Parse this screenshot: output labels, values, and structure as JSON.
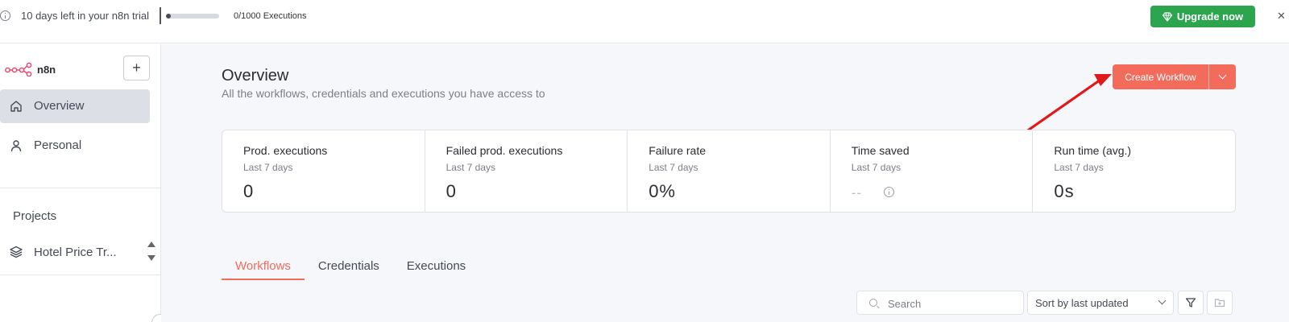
{
  "banner": {
    "trial_text": "10 days left in your n8n trial",
    "executions_text": "0/1000 Executions",
    "executions_progress": 0,
    "upgrade_label": "Upgrade now",
    "upgrade_color": "#2da44e"
  },
  "sidebar": {
    "logo_text": "n8n",
    "add_label": "+",
    "items": [
      {
        "label": "Overview",
        "icon": "home-icon",
        "active": true
      },
      {
        "label": "Personal",
        "icon": "user-icon",
        "active": false
      }
    ],
    "projects_label": "Projects",
    "projects": [
      {
        "label": "Hotel Price Tr...",
        "icon": "layers-icon"
      }
    ]
  },
  "main": {
    "title": "Overview",
    "subtitle": "All the workflows, credentials and executions you have access to",
    "create_label": "Create Workflow",
    "accent_color": "#f26b5b",
    "stats": [
      {
        "title": "Prod. executions",
        "sub": "Last 7 days",
        "value": "0"
      },
      {
        "title": "Failed prod. executions",
        "sub": "Last 7 days",
        "value": "0"
      },
      {
        "title": "Failure rate",
        "sub": "Last 7 days",
        "value": "0%"
      },
      {
        "title": "Time saved",
        "sub": "Last 7 days",
        "value": "--"
      },
      {
        "title": "Run time (avg.)",
        "sub": "Last 7 days",
        "value": "0s"
      }
    ],
    "tabs": [
      {
        "label": "Workflows",
        "active": true
      },
      {
        "label": "Credentials",
        "active": false
      },
      {
        "label": "Executions",
        "active": false
      }
    ],
    "search_placeholder": "Search",
    "sort_value": "Sort by last updated"
  }
}
